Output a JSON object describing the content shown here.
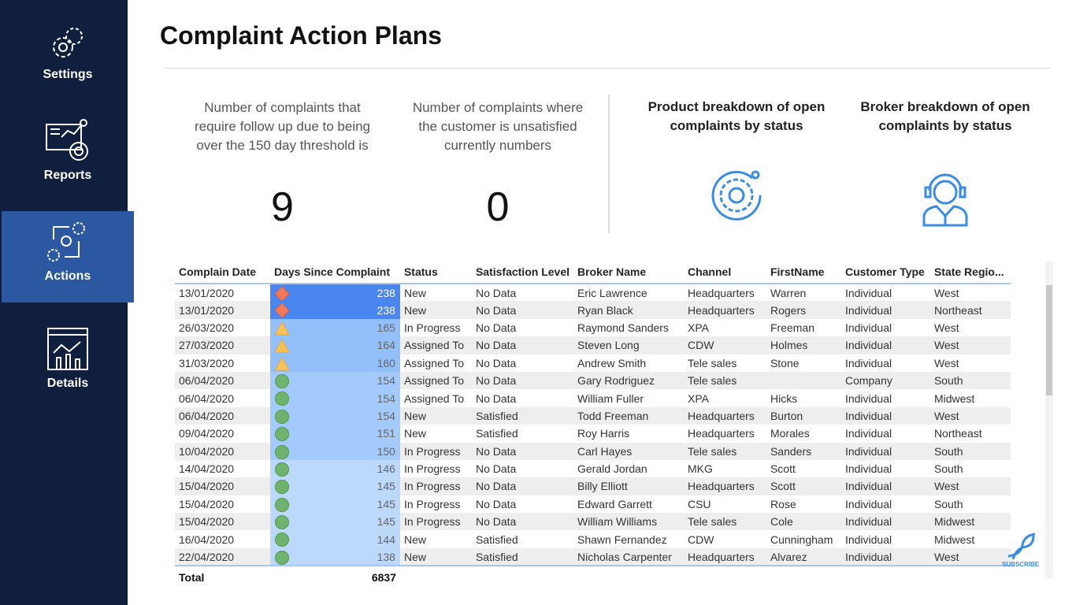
{
  "sidebar": {
    "items": [
      {
        "label": "Settings",
        "icon": "gear-icon"
      },
      {
        "label": "Reports",
        "icon": "report-icon"
      },
      {
        "label": "Actions",
        "icon": "actions-icon",
        "active": true
      },
      {
        "label": "Details",
        "icon": "details-icon"
      }
    ]
  },
  "header": {
    "title": "Complaint Action Plans"
  },
  "kpis": [
    {
      "text": "Number of complaints that require follow up due to being over the 150 day threshold is",
      "value": "9"
    },
    {
      "text": "Number of complaints where the customer is unsatisfied currently numbers",
      "value": "0"
    }
  ],
  "cards": [
    {
      "title": "Product breakdown of open complaints by status",
      "icon": "gear-circle-icon"
    },
    {
      "title": "Broker breakdown of open complaints by status",
      "icon": "headset-person-icon"
    }
  ],
  "table": {
    "columns": [
      "Complain Date",
      "Days Since Complaint",
      "Status",
      "Satisfaction Level",
      "Broker Name",
      "Channel",
      "FirstName",
      "Customer Type",
      "State Regio..."
    ],
    "rows": [
      [
        "13/01/2020",
        "238",
        "New",
        "No Data",
        "Eric Lawrence",
        "Headquarters",
        "Warren",
        "Individual",
        "West",
        "diamond"
      ],
      [
        "13/01/2020",
        "238",
        "New",
        "No Data",
        "Ryan Black",
        "Headquarters",
        "Rogers",
        "Individual",
        "Northeast",
        "diamond"
      ],
      [
        "26/03/2020",
        "165",
        "In Progress",
        "No Data",
        "Raymond Sanders",
        "XPA",
        "Freeman",
        "Individual",
        "West",
        "triangle"
      ],
      [
        "27/03/2020",
        "164",
        "Assigned To",
        "No Data",
        "Steven Long",
        "CDW",
        "Holmes",
        "Individual",
        "West",
        "triangle"
      ],
      [
        "31/03/2020",
        "160",
        "Assigned To",
        "No Data",
        "Andrew Smith",
        "Tele sales",
        "Stone",
        "Individual",
        "West",
        "triangle"
      ],
      [
        "06/04/2020",
        "154",
        "Assigned To",
        "No Data",
        "Gary Rodriguez",
        "Tele sales",
        "",
        "Company",
        "South",
        "circle"
      ],
      [
        "06/04/2020",
        "154",
        "Assigned To",
        "No Data",
        "William Fuller",
        "XPA",
        "Hicks",
        "Individual",
        "Midwest",
        "circle"
      ],
      [
        "06/04/2020",
        "154",
        "New",
        "Satisfied",
        "Todd Freeman",
        "Headquarters",
        "Burton",
        "Individual",
        "West",
        "circle"
      ],
      [
        "09/04/2020",
        "151",
        "New",
        "Satisfied",
        "Roy Harris",
        "Headquarters",
        "Morales",
        "Individual",
        "Northeast",
        "circle"
      ],
      [
        "10/04/2020",
        "150",
        "In Progress",
        "No Data",
        "Carl Hayes",
        "Tele sales",
        "Sanders",
        "Individual",
        "South",
        "circle"
      ],
      [
        "14/04/2020",
        "146",
        "In Progress",
        "No Data",
        "Gerald Jordan",
        "MKG",
        "Scott",
        "Individual",
        "South",
        "circle"
      ],
      [
        "15/04/2020",
        "145",
        "In Progress",
        "No Data",
        "Billy Elliott",
        "Headquarters",
        "Scott",
        "Individual",
        "West",
        "circle"
      ],
      [
        "15/04/2020",
        "145",
        "In Progress",
        "No Data",
        "Edward Garrett",
        "CSU",
        "Rose",
        "Individual",
        "South",
        "circle"
      ],
      [
        "15/04/2020",
        "145",
        "In Progress",
        "No Data",
        "William Williams",
        "Tele sales",
        "Cole",
        "Individual",
        "Midwest",
        "circle"
      ],
      [
        "16/04/2020",
        "144",
        "New",
        "Satisfied",
        "Shawn Fernandez",
        "CDW",
        "Cunningham",
        "Individual",
        "Midwest",
        "circle"
      ],
      [
        "22/04/2020",
        "138",
        "New",
        "Satisfied",
        "Nicholas Carpenter",
        "Headquarters",
        "Alvarez",
        "Individual",
        "West",
        "circle"
      ]
    ],
    "total": {
      "label": "Total",
      "days": "6837"
    }
  },
  "colors": {
    "sidebar": "#0f1f3d",
    "active": "#2b58a0",
    "diamond": "#f07a5a",
    "triangle": "#f5c25a",
    "circle": "#6fb36f"
  },
  "watermark": {
    "text": "SUBSCRIBE"
  }
}
